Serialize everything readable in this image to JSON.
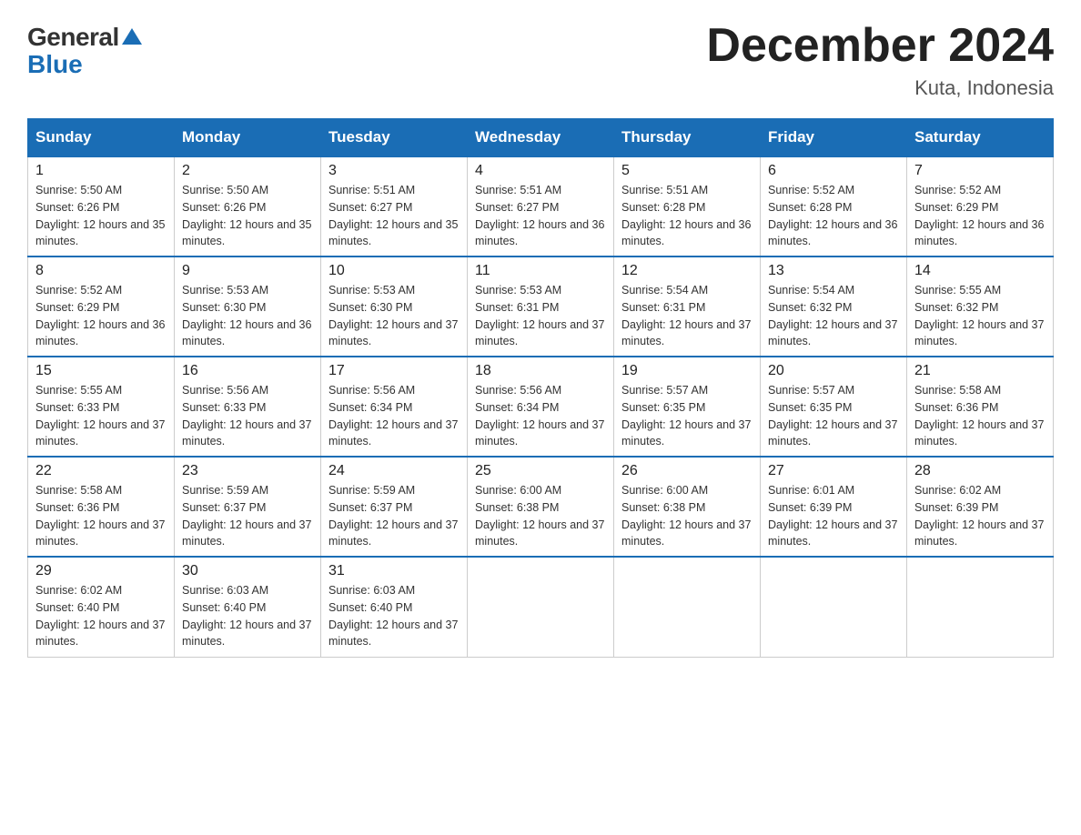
{
  "header": {
    "logo_general": "General",
    "logo_blue": "Blue",
    "month_title": "December 2024",
    "location": "Kuta, Indonesia"
  },
  "days_of_week": [
    "Sunday",
    "Monday",
    "Tuesday",
    "Wednesday",
    "Thursday",
    "Friday",
    "Saturday"
  ],
  "weeks": [
    [
      {
        "day": "1",
        "sunrise": "5:50 AM",
        "sunset": "6:26 PM",
        "daylight": "12 hours and 35 minutes."
      },
      {
        "day": "2",
        "sunrise": "5:50 AM",
        "sunset": "6:26 PM",
        "daylight": "12 hours and 35 minutes."
      },
      {
        "day": "3",
        "sunrise": "5:51 AM",
        "sunset": "6:27 PM",
        "daylight": "12 hours and 35 minutes."
      },
      {
        "day": "4",
        "sunrise": "5:51 AM",
        "sunset": "6:27 PM",
        "daylight": "12 hours and 36 minutes."
      },
      {
        "day": "5",
        "sunrise": "5:51 AM",
        "sunset": "6:28 PM",
        "daylight": "12 hours and 36 minutes."
      },
      {
        "day": "6",
        "sunrise": "5:52 AM",
        "sunset": "6:28 PM",
        "daylight": "12 hours and 36 minutes."
      },
      {
        "day": "7",
        "sunrise": "5:52 AM",
        "sunset": "6:29 PM",
        "daylight": "12 hours and 36 minutes."
      }
    ],
    [
      {
        "day": "8",
        "sunrise": "5:52 AM",
        "sunset": "6:29 PM",
        "daylight": "12 hours and 36 minutes."
      },
      {
        "day": "9",
        "sunrise": "5:53 AM",
        "sunset": "6:30 PM",
        "daylight": "12 hours and 36 minutes."
      },
      {
        "day": "10",
        "sunrise": "5:53 AM",
        "sunset": "6:30 PM",
        "daylight": "12 hours and 37 minutes."
      },
      {
        "day": "11",
        "sunrise": "5:53 AM",
        "sunset": "6:31 PM",
        "daylight": "12 hours and 37 minutes."
      },
      {
        "day": "12",
        "sunrise": "5:54 AM",
        "sunset": "6:31 PM",
        "daylight": "12 hours and 37 minutes."
      },
      {
        "day": "13",
        "sunrise": "5:54 AM",
        "sunset": "6:32 PM",
        "daylight": "12 hours and 37 minutes."
      },
      {
        "day": "14",
        "sunrise": "5:55 AM",
        "sunset": "6:32 PM",
        "daylight": "12 hours and 37 minutes."
      }
    ],
    [
      {
        "day": "15",
        "sunrise": "5:55 AM",
        "sunset": "6:33 PM",
        "daylight": "12 hours and 37 minutes."
      },
      {
        "day": "16",
        "sunrise": "5:56 AM",
        "sunset": "6:33 PM",
        "daylight": "12 hours and 37 minutes."
      },
      {
        "day": "17",
        "sunrise": "5:56 AM",
        "sunset": "6:34 PM",
        "daylight": "12 hours and 37 minutes."
      },
      {
        "day": "18",
        "sunrise": "5:56 AM",
        "sunset": "6:34 PM",
        "daylight": "12 hours and 37 minutes."
      },
      {
        "day": "19",
        "sunrise": "5:57 AM",
        "sunset": "6:35 PM",
        "daylight": "12 hours and 37 minutes."
      },
      {
        "day": "20",
        "sunrise": "5:57 AM",
        "sunset": "6:35 PM",
        "daylight": "12 hours and 37 minutes."
      },
      {
        "day": "21",
        "sunrise": "5:58 AM",
        "sunset": "6:36 PM",
        "daylight": "12 hours and 37 minutes."
      }
    ],
    [
      {
        "day": "22",
        "sunrise": "5:58 AM",
        "sunset": "6:36 PM",
        "daylight": "12 hours and 37 minutes."
      },
      {
        "day": "23",
        "sunrise": "5:59 AM",
        "sunset": "6:37 PM",
        "daylight": "12 hours and 37 minutes."
      },
      {
        "day": "24",
        "sunrise": "5:59 AM",
        "sunset": "6:37 PM",
        "daylight": "12 hours and 37 minutes."
      },
      {
        "day": "25",
        "sunrise": "6:00 AM",
        "sunset": "6:38 PM",
        "daylight": "12 hours and 37 minutes."
      },
      {
        "day": "26",
        "sunrise": "6:00 AM",
        "sunset": "6:38 PM",
        "daylight": "12 hours and 37 minutes."
      },
      {
        "day": "27",
        "sunrise": "6:01 AM",
        "sunset": "6:39 PM",
        "daylight": "12 hours and 37 minutes."
      },
      {
        "day": "28",
        "sunrise": "6:02 AM",
        "sunset": "6:39 PM",
        "daylight": "12 hours and 37 minutes."
      }
    ],
    [
      {
        "day": "29",
        "sunrise": "6:02 AM",
        "sunset": "6:40 PM",
        "daylight": "12 hours and 37 minutes."
      },
      {
        "day": "30",
        "sunrise": "6:03 AM",
        "sunset": "6:40 PM",
        "daylight": "12 hours and 37 minutes."
      },
      {
        "day": "31",
        "sunrise": "6:03 AM",
        "sunset": "6:40 PM",
        "daylight": "12 hours and 37 minutes."
      },
      null,
      null,
      null,
      null
    ]
  ]
}
